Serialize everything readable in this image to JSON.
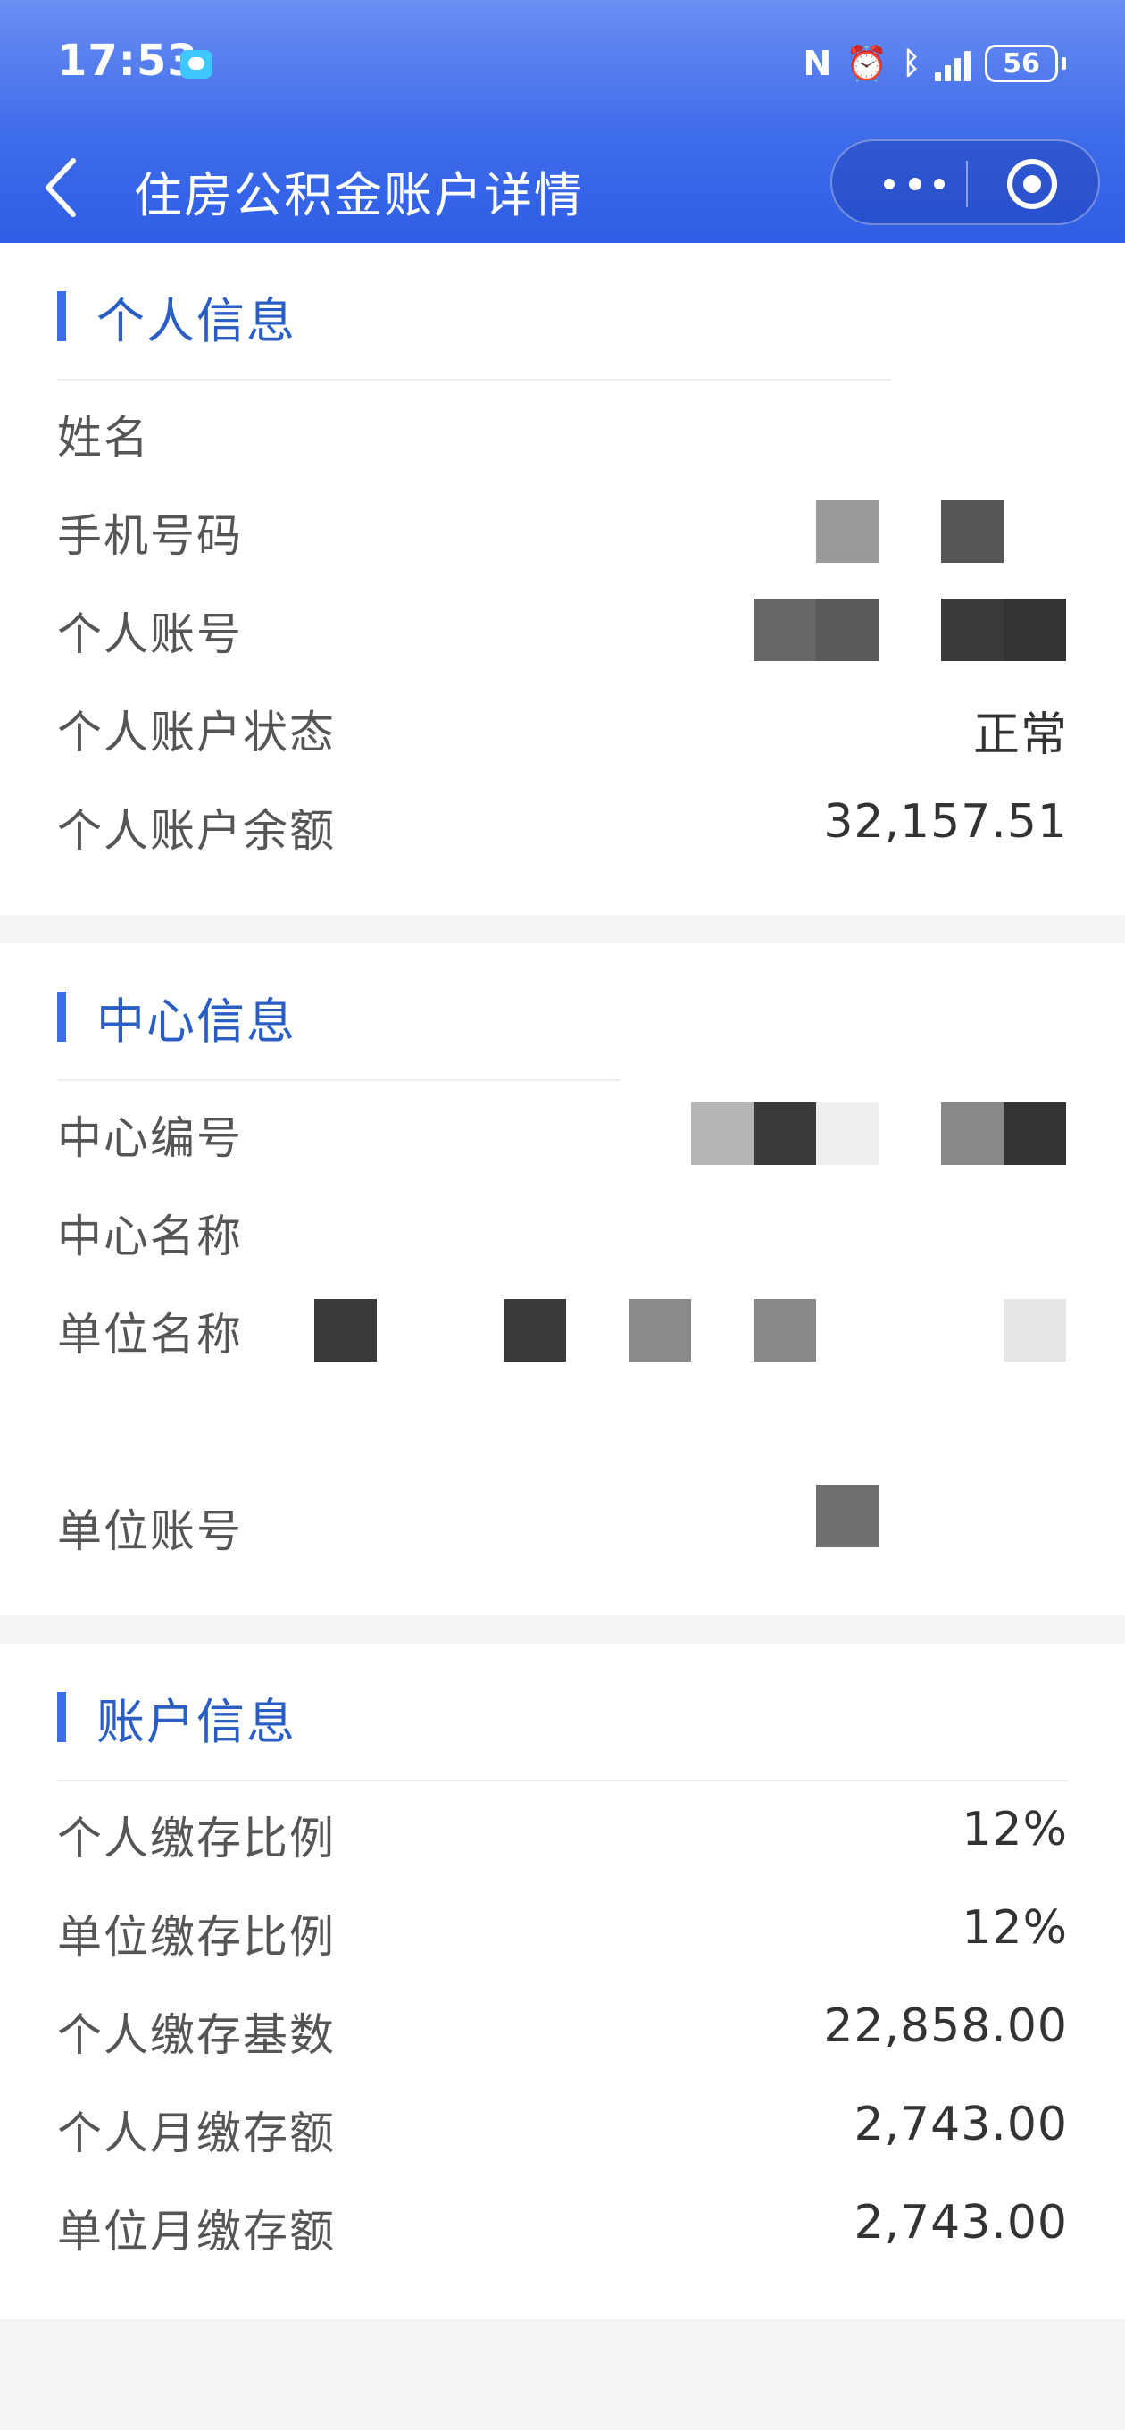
{
  "status_bar": {
    "time": "17:53",
    "battery": "56",
    "icons": [
      "message-icon",
      "nfc-icon",
      "alarm-icon",
      "bluetooth-icon",
      "signal-icon",
      "battery-icon"
    ]
  },
  "nav": {
    "title": "住房公积金账户详情",
    "icons": [
      "back-icon",
      "more-icon",
      "close-miniprogram-icon"
    ]
  },
  "personal": {
    "title": "个人信息",
    "rows": [
      {
        "label": "姓名",
        "value": ""
      },
      {
        "label": "手机号码",
        "value": ""
      },
      {
        "label": "个人账号",
        "value": ""
      },
      {
        "label": "个人账户状态",
        "value": "正常"
      },
      {
        "label": "个人账户余额",
        "value": "32,157.51"
      }
    ]
  },
  "center": {
    "title": "中心信息",
    "rows": [
      {
        "label": "中心编号",
        "value": ""
      },
      {
        "label": "中心名称",
        "value": ""
      },
      {
        "label": "单位名称",
        "value": ""
      },
      {
        "label": "单位账号",
        "value": ""
      }
    ]
  },
  "account": {
    "title": "账户信息",
    "rows": [
      {
        "label": "个人缴存比例",
        "value": "12%"
      },
      {
        "label": "单位缴存比例",
        "value": "12%"
      },
      {
        "label": "个人缴存基数",
        "value": "22,858.00"
      },
      {
        "label": "个人月缴存额",
        "value": "2,743.00"
      },
      {
        "label": "单位月缴存额",
        "value": "2,743.00"
      }
    ]
  },
  "colors": {
    "header": "#3f6cea",
    "section_accent": "#3d6ee8",
    "section_title": "#2a5ec4",
    "redaction_tones": [
      "#9a9a9a",
      "#555555",
      "#666666",
      "#3a3a3a",
      "#b5b5b5",
      "#eeeeee",
      "#888888",
      "#333333",
      "#e6e6e6",
      "#6f6f6f"
    ]
  }
}
